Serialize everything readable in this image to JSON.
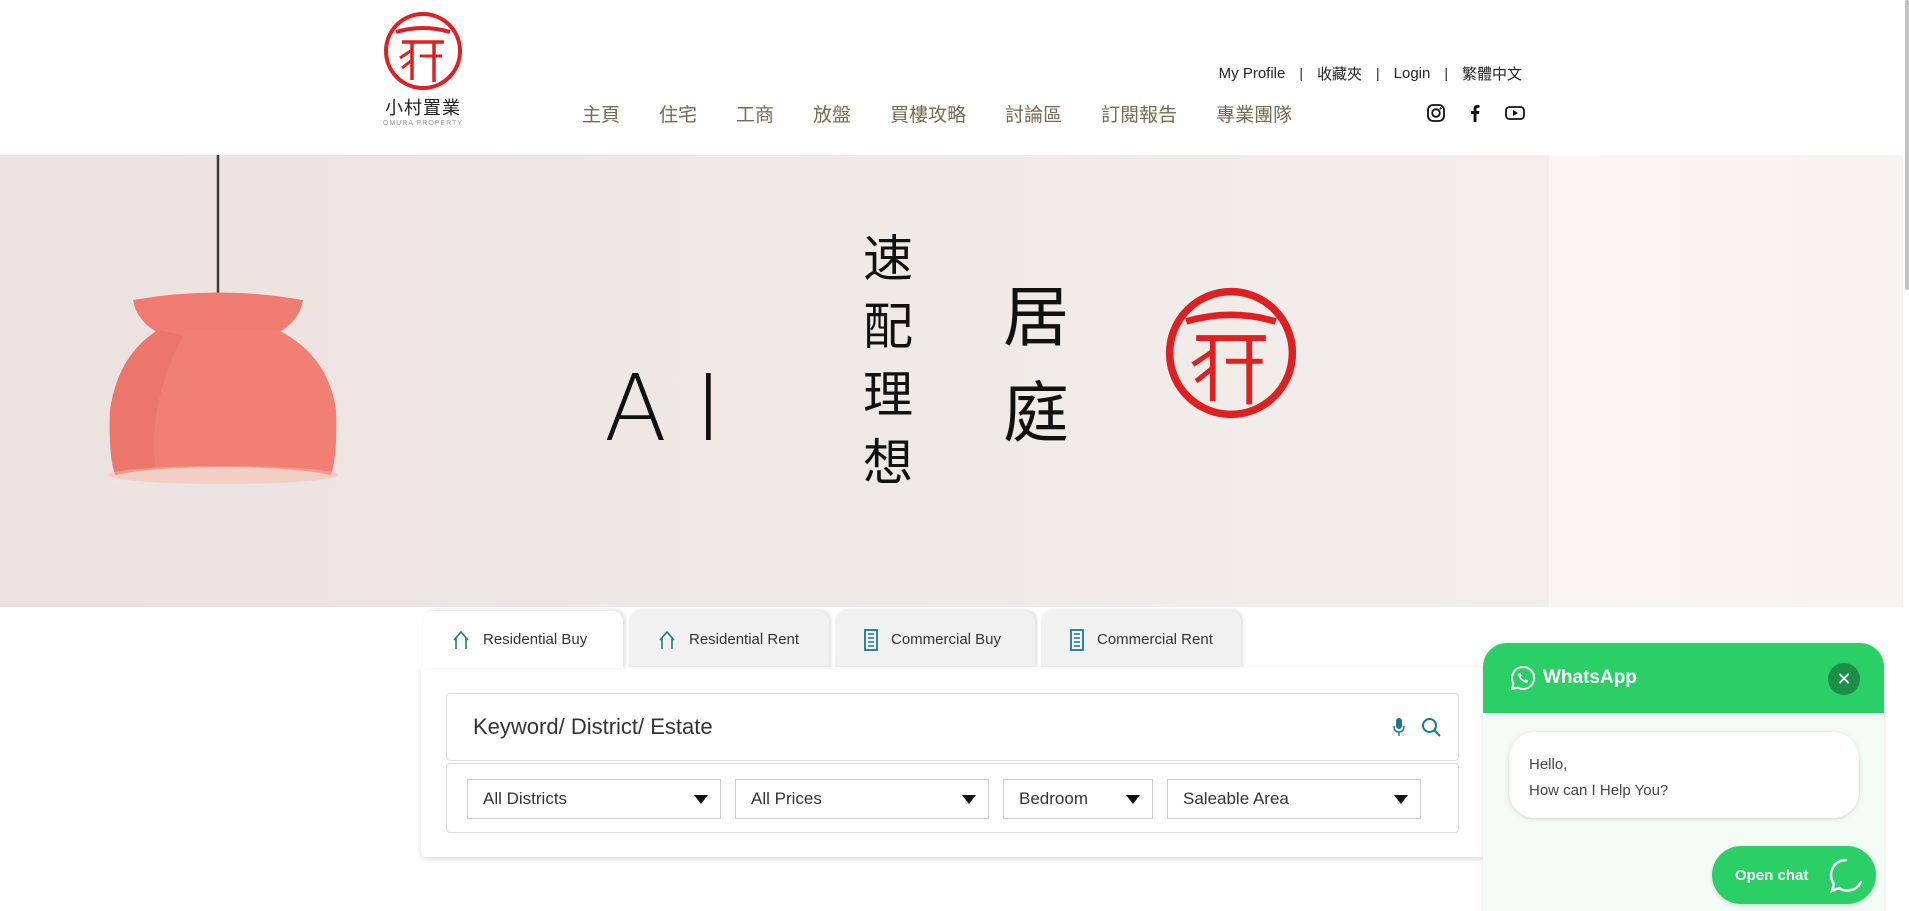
{
  "brand": {
    "name_cn": "小村置業",
    "name_en": "OMURA PROPERTY",
    "seal_color": "#e02020"
  },
  "topnav": {
    "profile": "My Profile",
    "favorites": "收藏夾",
    "login": "Login",
    "language": "繁體中文",
    "separator": "|"
  },
  "mainnav": {
    "items": [
      "主頁",
      "住宅",
      "工商",
      "放盤",
      "買樓攻略",
      "討論區",
      "訂閱報告",
      "專業團隊"
    ],
    "color": "#7a6a4f"
  },
  "social": [
    "instagram-icon",
    "facebook-icon",
    "youtube-icon"
  ],
  "hero": {
    "ai": "AI",
    "col1": [
      "速",
      "配",
      "理",
      "想"
    ],
    "col2": [
      "居",
      "庭"
    ]
  },
  "tabs": [
    {
      "label": "Residential Buy",
      "icon": "house-icon",
      "active": true
    },
    {
      "label": "Residential Rent",
      "icon": "house-icon",
      "active": false
    },
    {
      "label": "Commercial Buy",
      "icon": "building-icon",
      "active": false
    },
    {
      "label": "Commercial Rent",
      "icon": "building-icon",
      "active": false
    }
  ],
  "search": {
    "placeholder": "Keyword/ District/ Estate",
    "accent_color": "#1a7a8c"
  },
  "filters": {
    "district": "All Districts",
    "price": "All Prices",
    "bedroom": "Bedroom",
    "area": "Saleable Area"
  },
  "whatsapp": {
    "title": "WhatsApp",
    "close": "✕",
    "greeting_line1": "Hello,",
    "greeting_line2": "How can I Help You?",
    "open_chat": "Open chat",
    "color": "#2ad066"
  }
}
